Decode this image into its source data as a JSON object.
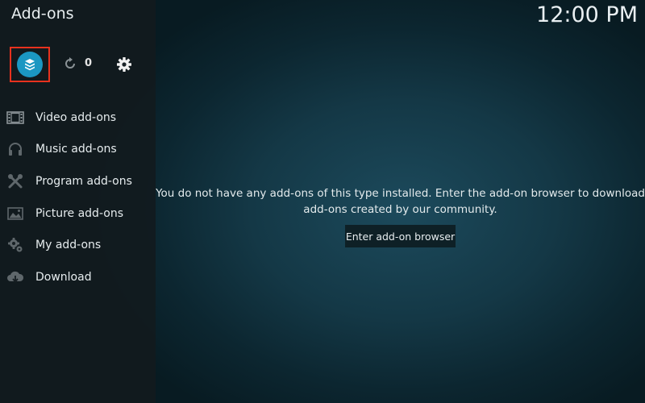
{
  "header": {
    "title": "Add-ons",
    "clock": "12:00 PM"
  },
  "toolbar": {
    "addon_browser_icon": "open-box-icon",
    "update_icon": "refresh-icon",
    "update_count": "0",
    "settings_icon": "gear-icon",
    "highlight_color": "#e8321e",
    "accent_color": "#1b97c2"
  },
  "sidebar": {
    "items": [
      {
        "label": "Video add-ons",
        "icon": "film-icon"
      },
      {
        "label": "Music add-ons",
        "icon": "headphones-icon"
      },
      {
        "label": "Program add-ons",
        "icon": "tools-icon"
      },
      {
        "label": "Picture add-ons",
        "icon": "picture-icon"
      },
      {
        "label": "My add-ons",
        "icon": "gear-box-icon"
      },
      {
        "label": "Download",
        "icon": "cloud-download-icon"
      }
    ]
  },
  "main": {
    "message_line1": "You do not have any add-ons of this type installed. Enter the add-on browser to download",
    "message_line2": "add-ons created by our community.",
    "enter_button": "Enter add-on browser"
  }
}
